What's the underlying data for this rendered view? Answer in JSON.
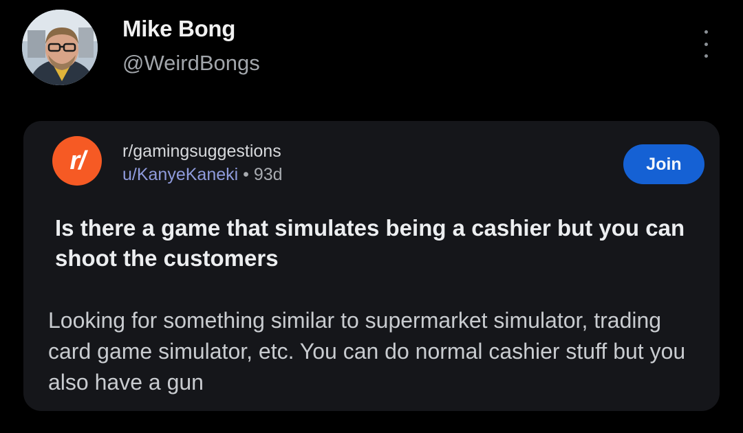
{
  "tweet": {
    "author_name": "Mike Bong",
    "author_handle": "@WeirdBongs",
    "more_icon": "more-vertical-icon"
  },
  "embed": {
    "subreddit_icon": "r/",
    "subreddit": "r/gamingsuggestions",
    "username": "u/KanyeKaneki",
    "separator": " • ",
    "age": "93d",
    "join_label": "Join",
    "title": "Is there a game that simulates being a cashier but you can shoot the customers",
    "body": "Looking for something similar to supermarket simulator, trading card game simulator, etc. You can do normal cashier stuff but you also have a gun"
  },
  "colors": {
    "background": "#000000",
    "card": "#15161a",
    "reddit_orange": "#f65a24",
    "join_blue": "#1561d4",
    "username_blue": "#8f9bdc"
  }
}
